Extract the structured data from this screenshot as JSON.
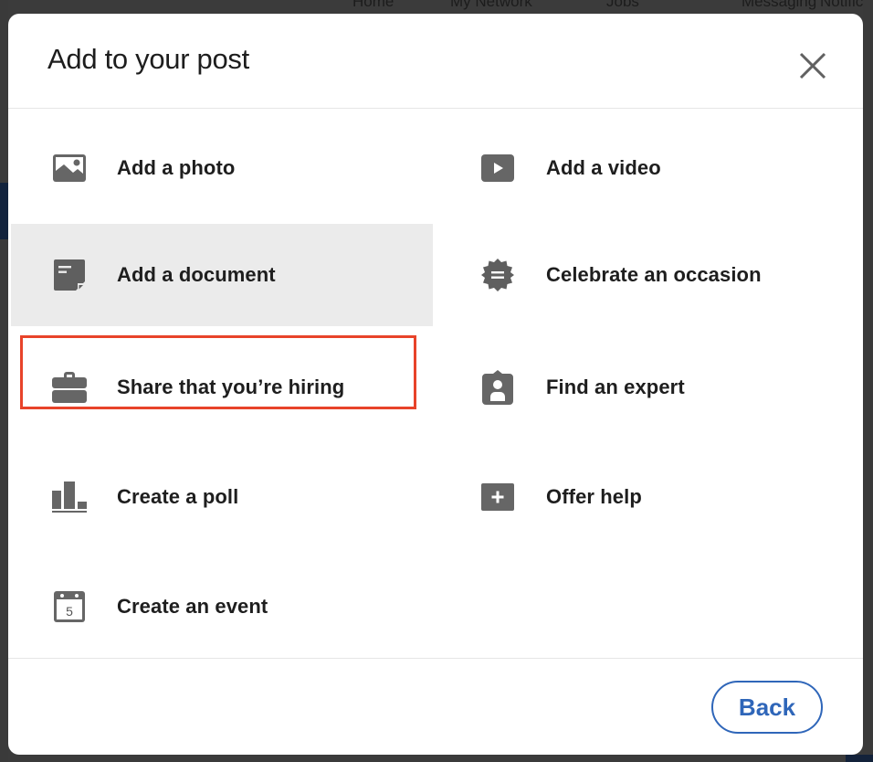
{
  "background": {
    "nav_items": [
      "Home",
      "My Network",
      "Jobs",
      "Messaging",
      "Notifications"
    ]
  },
  "modal": {
    "title": "Add to your post",
    "close_icon": "close-icon",
    "options": [
      {
        "id": "photo",
        "label": "Add a photo",
        "icon": "image-icon"
      },
      {
        "id": "video",
        "label": "Add a video",
        "icon": "video-play-icon"
      },
      {
        "id": "document",
        "label": "Add a document",
        "icon": "document-icon",
        "selected": true
      },
      {
        "id": "occasion",
        "label": "Celebrate an occasion",
        "icon": "celebrate-badge-icon"
      },
      {
        "id": "hiring",
        "label": "Share that you’re hiring",
        "icon": "briefcase-icon"
      },
      {
        "id": "expert",
        "label": "Find an expert",
        "icon": "expert-badge-icon"
      },
      {
        "id": "poll",
        "label": "Create a poll",
        "icon": "poll-chart-icon"
      },
      {
        "id": "help",
        "label": "Offer help",
        "icon": "plus-box-icon"
      },
      {
        "id": "event",
        "label": "Create an event",
        "icon": "calendar-icon",
        "calendar_day": "5"
      }
    ],
    "footer": {
      "back_label": "Back"
    }
  },
  "colors": {
    "icon": "#666666",
    "text": "#1e1e1e",
    "selected_bg": "#ebebeb",
    "highlight_border": "#e8432a",
    "primary": "#2f66b9",
    "overlay": "#3b3b3b"
  }
}
